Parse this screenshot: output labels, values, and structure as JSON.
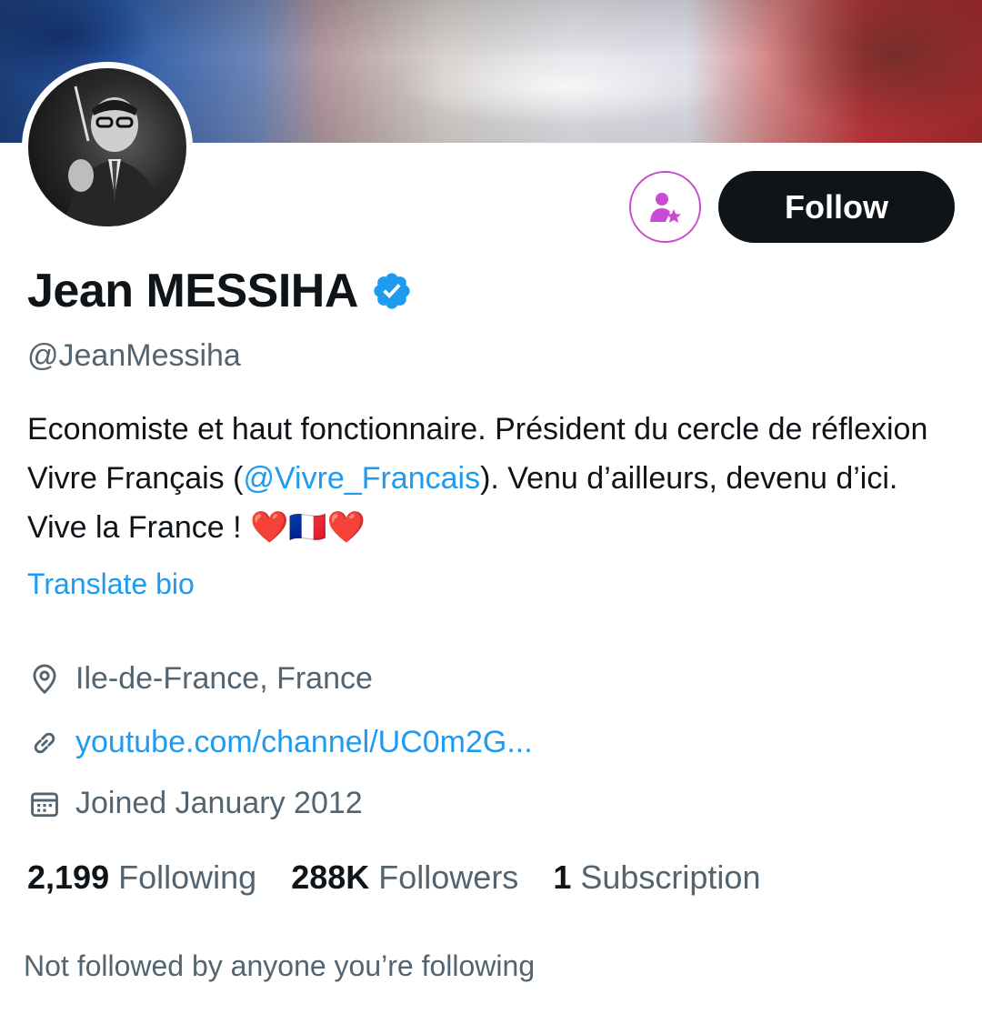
{
  "profile": {
    "name": "Jean MESSIHA",
    "handle": "@JeanMessiha",
    "verified": true,
    "bio": {
      "part1": "Economiste et haut fonctionnaire. Président du cercle de réflexion Vivre Français (",
      "mention": "@Vivre_Francais",
      "part2": "). Venu d’ailleurs, devenu d’ici. Vive la France ! ❤️🇫🇷❤️"
    },
    "translate_label": "Translate bio",
    "location": "Ile-de-France, France",
    "website": "youtube.com/channel/UC0m2G...",
    "joined": "Joined January 2012"
  },
  "actions": {
    "follow_label": "Follow",
    "subscribe_icon": "person-star-icon"
  },
  "stats": {
    "following_count": "2,199",
    "following_label": "Following",
    "followers_count": "288K",
    "followers_label": "Followers",
    "subscriptions_count": "1",
    "subscriptions_label": "Subscription"
  },
  "followed_by_text": "Not followed by anyone you’re following",
  "colors": {
    "accent": "#1d9bf0",
    "text": "#0f1419",
    "secondary_text": "#536471",
    "subscribe_accent": "#c94bd4"
  }
}
